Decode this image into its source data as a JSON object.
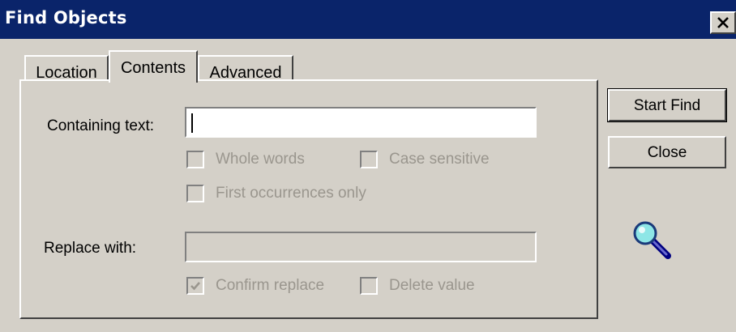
{
  "window": {
    "title": "Find Objects",
    "close_glyph": "✕"
  },
  "tabs": [
    {
      "label": "Location",
      "active": false
    },
    {
      "label": "Contents",
      "active": true
    },
    {
      "label": "Advanced",
      "active": false
    }
  ],
  "contents": {
    "containing_text_label": "Containing text:",
    "containing_text_value": "",
    "whole_words_label": "Whole words",
    "whole_words_checked": false,
    "case_sensitive_label": "Case sensitive",
    "case_sensitive_checked": false,
    "first_occurrences_label": "First occurrences only",
    "first_occurrences_checked": false,
    "replace_with_label": "Replace with:",
    "replace_with_value": "",
    "confirm_replace_label": "Confirm replace",
    "confirm_replace_checked": true,
    "delete_value_label": "Delete value",
    "delete_value_checked": false
  },
  "buttons": {
    "start_find": "Start Find",
    "close": "Close"
  },
  "icons": {
    "find": "magnifier-icon"
  },
  "colors": {
    "titlebar": "#0a246a",
    "face": "#d4d0c8",
    "disabled_text": "#9a968e"
  }
}
